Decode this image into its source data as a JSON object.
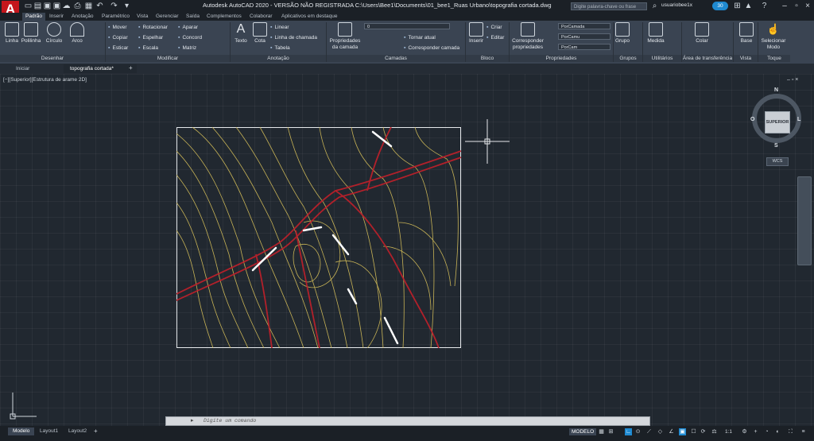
{
  "app": {
    "logo_letter": "A",
    "title": "Autodesk AutoCAD 2020 - VERSÃO NÃO REGISTRADA    C:\\Users\\Bee1\\Documents\\01_bee1_Ruas Urbano\\topografia cortada.dwg"
  },
  "search": {
    "placeholder": "Digite palavra-chave ou frase"
  },
  "user": {
    "name": "usuariobee1x",
    "badge": "30"
  },
  "ribbon_tabs": [
    "Padrão",
    "Inserir",
    "Anotação",
    "Paramétrico",
    "Vista",
    "Gerenciar",
    "Saída",
    "Complementos",
    "Colaborar",
    "Aplicativos em destaque"
  ],
  "draw": {
    "linha": "Linha",
    "polilinha": "Polilinha",
    "circulo": "Círculo",
    "arco": "Arco",
    "title": "Desenhar"
  },
  "modify": {
    "items": [
      "Mover",
      "Rotacionar",
      "Aparar",
      "Copiar",
      "Espelhar",
      "Concord",
      "Esticar",
      "Escala",
      "Matriz"
    ],
    "title": "Modificar"
  },
  "annot": {
    "texto": "Texto",
    "cota": "Cota",
    "linear": "Linear",
    "chamada": "Linha de chamada",
    "tabela": "Tabela",
    "title": "Anotação"
  },
  "layers": {
    "props": "Propriedades da camada",
    "current": "0",
    "tornar": "Tornar atual",
    "corresp": "Corresponder camada",
    "title": "Camadas"
  },
  "block": {
    "inserir": "Inserir",
    "criar": "Criar",
    "editar": "Editar",
    "title": "Bloco"
  },
  "props": {
    "corresp": "Corresponder propriedades",
    "c1": "PorCamada",
    "c2": "PorCamu",
    "c3": "PorCam",
    "title": "Propriedades"
  },
  "groups": {
    "grupo": "Grupo",
    "title": "Grupos"
  },
  "util": {
    "medida": "Medida",
    "title": "Utilitários"
  },
  "clip": {
    "colar": "Colar",
    "title": "Área de transferência"
  },
  "view": {
    "base": "Base",
    "title": "Vista"
  },
  "touch": {
    "sel": "Selecionar Modo",
    "title": "Toque"
  },
  "doc_tabs": {
    "start": "Iniciar",
    "file": "topografia cortada*"
  },
  "viewport": {
    "label": "[−][Superior][Estrutura de arame 2D]"
  },
  "viewcube": {
    "face": "SUPERIOR",
    "n": "N",
    "s": "S",
    "o": "O",
    "l": "L",
    "wcs": "WCS"
  },
  "command": {
    "placeholder": "Digite um comando"
  },
  "layout_tabs": [
    "Modelo",
    "Layout1",
    "Layout2"
  ],
  "status": {
    "modelo": "MODELO",
    "scale": "1:1"
  }
}
